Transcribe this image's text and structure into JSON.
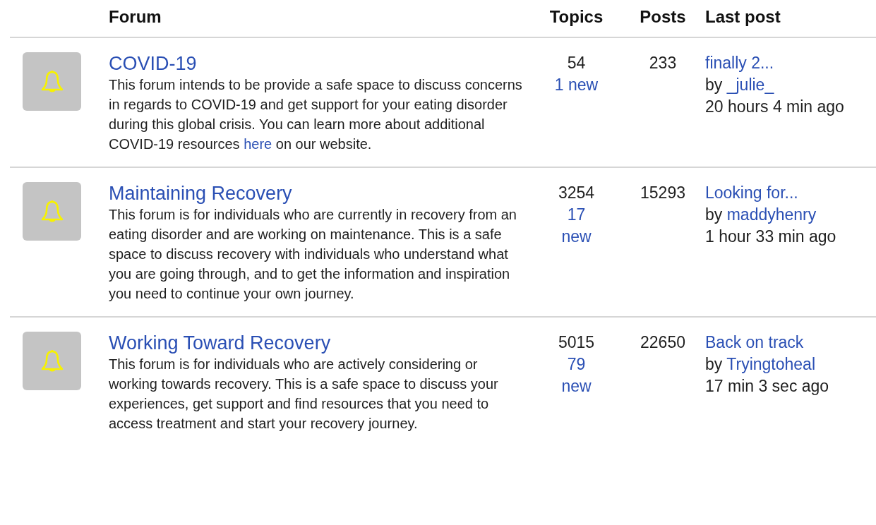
{
  "columns": [
    "Forum",
    "Topics",
    "Posts",
    "Last post"
  ],
  "forums": [
    {
      "title": "COVID-19",
      "description": {
        "before": "This forum intends to be provide a safe space to discuss concerns in regards to COVID-19 and get support for your eating disorder during this global crisis. You can learn more about additional COVID-19 resources ",
        "link": "here",
        "after": " on our website."
      },
      "topics": "54",
      "new_topics": "1 new",
      "posts": "233",
      "last_post": {
        "title": "finally 2...",
        "by": "by",
        "author": "_julie_",
        "time": "20 hours 4 min ago"
      }
    },
    {
      "title": "Maintaining Recovery",
      "description": {
        "before": "This forum is for individuals who are currently in recovery from an eating disorder and are working on maintenance. This is a safe space to discuss recovery with individuals who understand what you are going through, and to get the information and inspiration you need to continue your own journey."
      },
      "topics": "3254",
      "new_topics": "17 new",
      "posts": "15293",
      "last_post": {
        "title": "Looking for...",
        "by": "by",
        "author": "maddyhenry",
        "time": "1 hour 33 min ago"
      }
    },
    {
      "title": "Working Toward Recovery",
      "description": {
        "before": "This forum is for individuals who are actively considering or working towards recovery. This is a safe space to discuss your experiences, get support and find resources that you need to access treatment and start your recovery journey."
      },
      "topics": "5015",
      "new_topics": "79 new",
      "posts": "22650",
      "last_post": {
        "title": "Back on track",
        "by": "by",
        "author": "Tryingtoheal",
        "time": "17 min 3 sec ago"
      }
    }
  ]
}
